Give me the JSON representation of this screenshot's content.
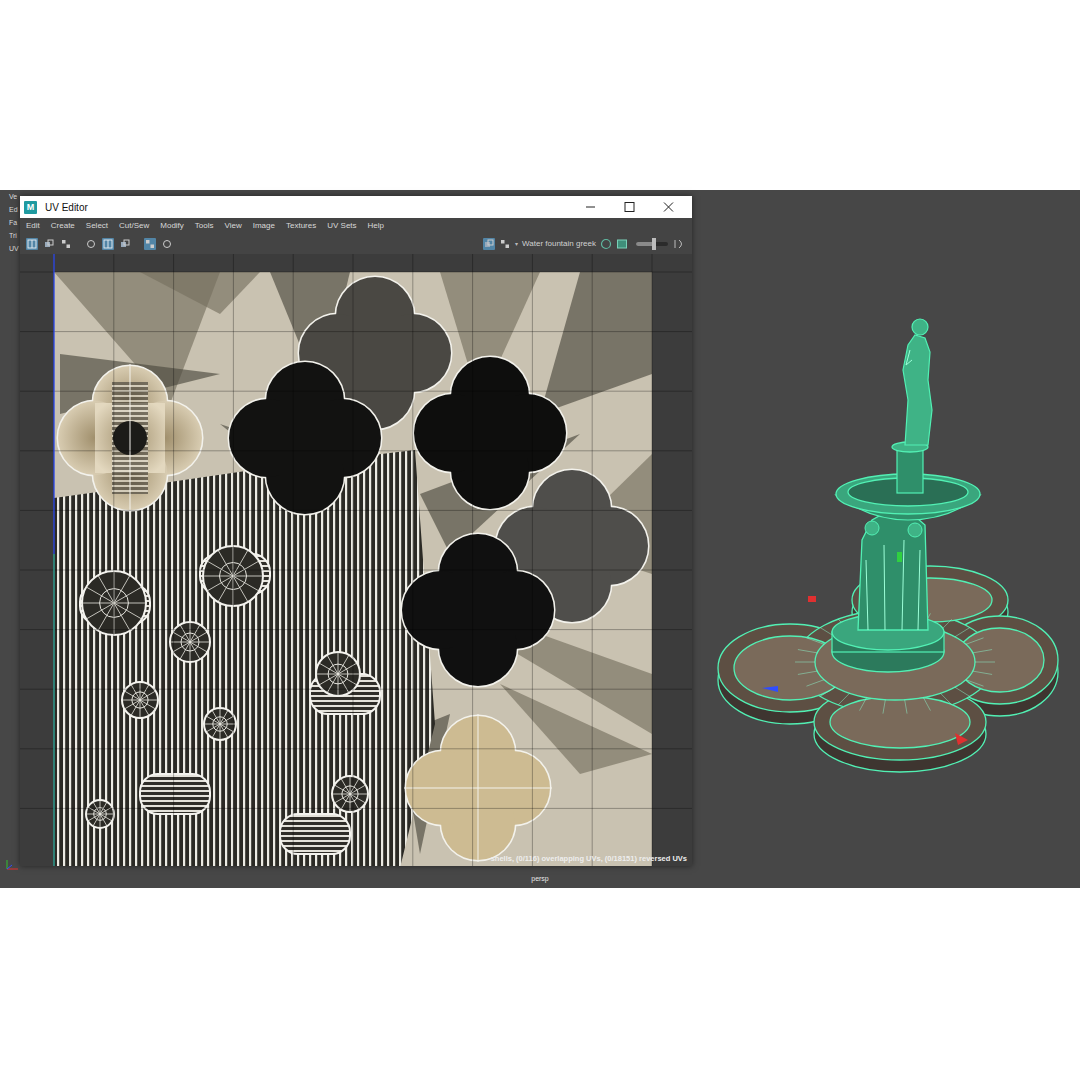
{
  "hud": {
    "labels": [
      "Ve",
      "Ed",
      "Fa",
      "Tri",
      "UV"
    ]
  },
  "window": {
    "title": "UV Editor",
    "logo": "M"
  },
  "menu": [
    "Edit",
    "Create",
    "Select",
    "Cut/Sew",
    "Modify",
    "Tools",
    "View",
    "Image",
    "Textures",
    "UV Sets",
    "Help"
  ],
  "toolbar": {
    "left_tools": [
      {
        "selected": true
      },
      {
        "selected": false
      },
      {
        "selected": false
      },
      {
        "selected": false
      },
      {
        "selected": true
      },
      {
        "selected": false
      },
      {
        "selected": true
      },
      {
        "selected": false
      }
    ],
    "right_tools": [
      {
        "selected": true
      },
      {
        "selected": false
      }
    ],
    "uv_set": "Water fountain greek",
    "brightness": {
      "level": 0.55
    }
  },
  "status": "shells, (0/116) overlapping UVs, (0/18151) reversed UVs",
  "viewport": {
    "camera": "persp"
  }
}
